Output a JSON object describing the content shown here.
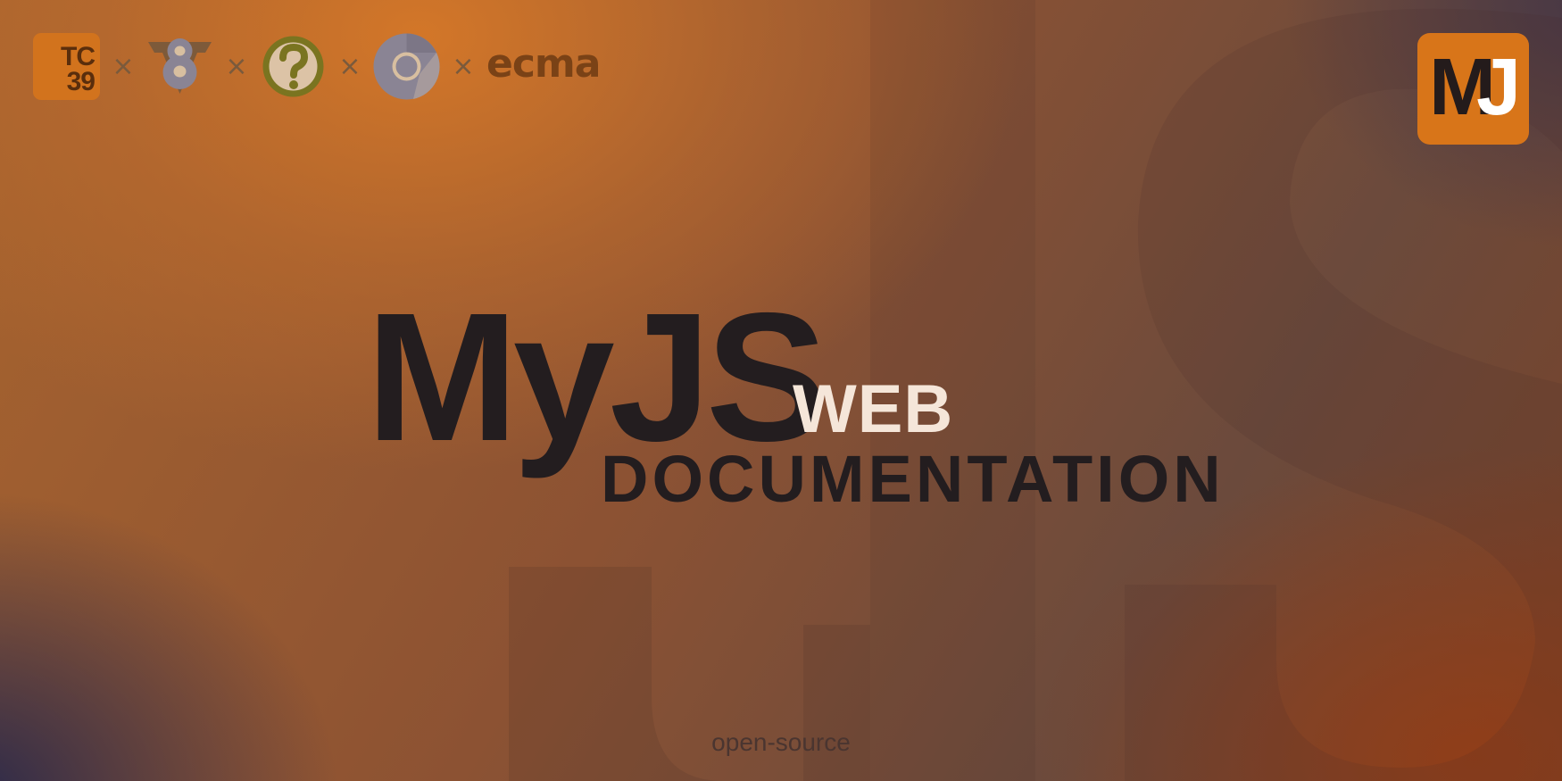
{
  "logos": {
    "tc39_line1": "TC",
    "tc39_line2": "39",
    "separator": "×",
    "ecma": "ecma"
  },
  "badge": {
    "letter_m": "M",
    "letter_j": "J"
  },
  "hero": {
    "title": "MyJS",
    "web": "WEB",
    "subtitle": "DOCUMENTATION"
  },
  "footer": {
    "text": "open-source"
  },
  "colors": {
    "accent": "#d87519",
    "dark_text": "#231d1f",
    "light_text": "#f5e6d9"
  }
}
